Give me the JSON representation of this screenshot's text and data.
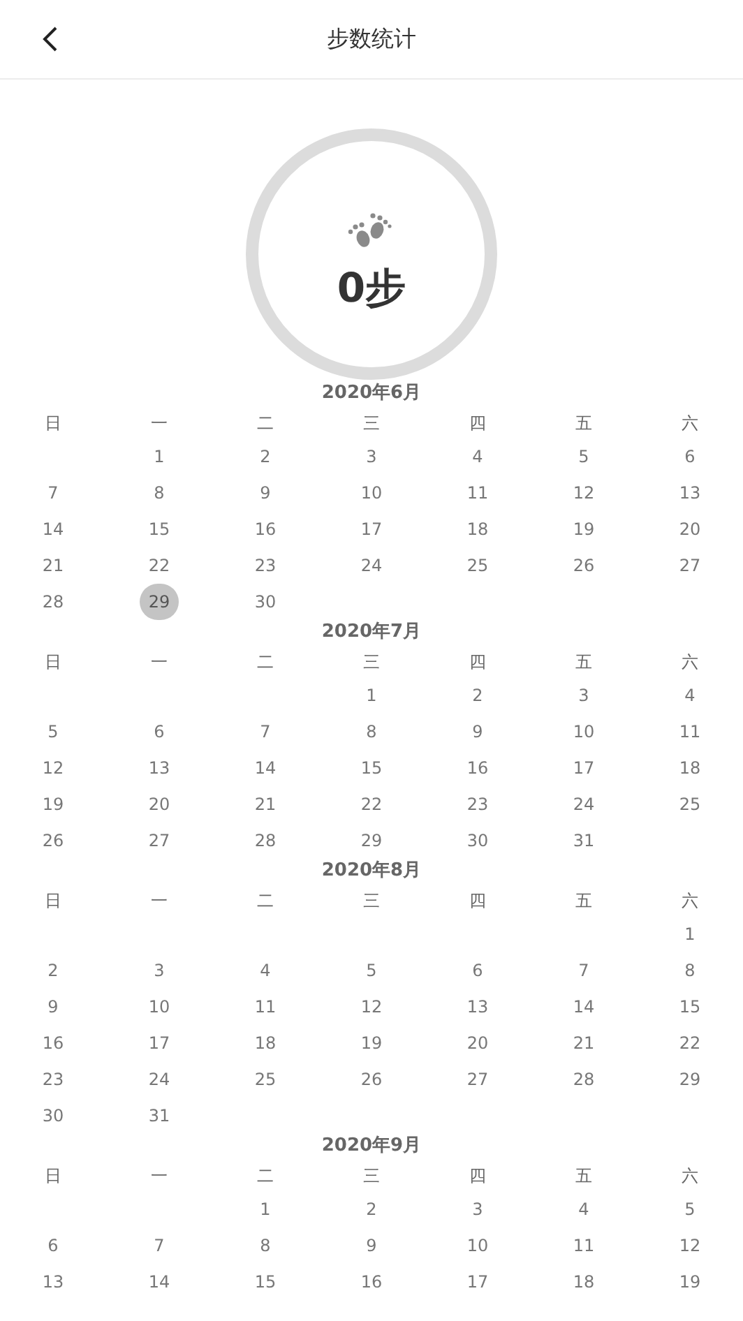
{
  "header": {
    "title": "步数统计"
  },
  "summary": {
    "steps": "0步"
  },
  "months": [
    {
      "title": "2020年6月",
      "weekdays": [
        "日",
        "一",
        "二",
        "三",
        "四",
        "五",
        "六"
      ],
      "weeks": [
        {
          "starts_midweek": true,
          "days": [
            {
              "day": "1",
              "selected": false
            },
            {
              "day": "2",
              "selected": false
            },
            {
              "day": "3",
              "selected": false
            },
            {
              "day": "4",
              "selected": false
            },
            {
              "day": "5",
              "selected": false
            },
            {
              "day": "6",
              "selected": false
            }
          ]
        },
        {
          "days": [
            {
              "day": "7",
              "selected": false
            },
            {
              "day": "8",
              "selected": false
            },
            {
              "day": "9",
              "selected": false
            },
            {
              "day": "10",
              "selected": false
            },
            {
              "day": "11",
              "selected": false
            },
            {
              "day": "12",
              "selected": false
            },
            {
              "day": "13",
              "selected": false
            }
          ]
        },
        {
          "days": [
            {
              "day": "14",
              "selected": false
            },
            {
              "day": "15",
              "selected": false
            },
            {
              "day": "16",
              "selected": false
            },
            {
              "day": "17",
              "selected": false
            },
            {
              "day": "18",
              "selected": false
            },
            {
              "day": "19",
              "selected": false
            },
            {
              "day": "20",
              "selected": false
            }
          ]
        },
        {
          "days": [
            {
              "day": "21",
              "selected": false
            },
            {
              "day": "22",
              "selected": false
            },
            {
              "day": "23",
              "selected": false
            },
            {
              "day": "24",
              "selected": false
            },
            {
              "day": "25",
              "selected": false
            },
            {
              "day": "26",
              "selected": false
            },
            {
              "day": "27",
              "selected": false
            }
          ]
        },
        {
          "starts_midweek": false,
          "days": [
            {
              "day": "28",
              "selected": false
            },
            {
              "day": "29",
              "selected": true
            },
            {
              "day": "30",
              "selected": false
            }
          ]
        }
      ]
    },
    {
      "title": "2020年7月",
      "weekdays": [
        "日",
        "一",
        "二",
        "三",
        "四",
        "五",
        "六"
      ],
      "weeks": [
        {
          "starts_midweek": true,
          "days": [
            {
              "day": "1",
              "selected": false
            },
            {
              "day": "2",
              "selected": false
            },
            {
              "day": "3",
              "selected": false
            },
            {
              "day": "4",
              "selected": false
            }
          ]
        },
        {
          "days": [
            {
              "day": "5",
              "selected": false
            },
            {
              "day": "6",
              "selected": false
            },
            {
              "day": "7",
              "selected": false
            },
            {
              "day": "8",
              "selected": false
            },
            {
              "day": "9",
              "selected": false
            },
            {
              "day": "10",
              "selected": false
            },
            {
              "day": "11",
              "selected": false
            }
          ]
        },
        {
          "days": [
            {
              "day": "12",
              "selected": false
            },
            {
              "day": "13",
              "selected": false
            },
            {
              "day": "14",
              "selected": false
            },
            {
              "day": "15",
              "selected": false
            },
            {
              "day": "16",
              "selected": false
            },
            {
              "day": "17",
              "selected": false
            },
            {
              "day": "18",
              "selected": false
            }
          ]
        },
        {
          "days": [
            {
              "day": "19",
              "selected": false
            },
            {
              "day": "20",
              "selected": false
            },
            {
              "day": "21",
              "selected": false
            },
            {
              "day": "22",
              "selected": false
            },
            {
              "day": "23",
              "selected": false
            },
            {
              "day": "24",
              "selected": false
            },
            {
              "day": "25",
              "selected": false
            }
          ]
        },
        {
          "starts_midweek": false,
          "days": [
            {
              "day": "26",
              "selected": false
            },
            {
              "day": "27",
              "selected": false
            },
            {
              "day": "28",
              "selected": false
            },
            {
              "day": "29",
              "selected": false
            },
            {
              "day": "30",
              "selected": false
            },
            {
              "day": "31",
              "selected": false
            }
          ]
        }
      ]
    },
    {
      "title": "2020年8月",
      "weekdays": [
        "日",
        "一",
        "二",
        "三",
        "四",
        "五",
        "六"
      ],
      "weeks": [
        {
          "starts_midweek": true,
          "days": [
            {
              "day": "1",
              "selected": false
            }
          ]
        },
        {
          "days": [
            {
              "day": "2",
              "selected": false
            },
            {
              "day": "3",
              "selected": false
            },
            {
              "day": "4",
              "selected": false
            },
            {
              "day": "5",
              "selected": false
            },
            {
              "day": "6",
              "selected": false
            },
            {
              "day": "7",
              "selected": false
            },
            {
              "day": "8",
              "selected": false
            }
          ]
        },
        {
          "days": [
            {
              "day": "9",
              "selected": false
            },
            {
              "day": "10",
              "selected": false
            },
            {
              "day": "11",
              "selected": false
            },
            {
              "day": "12",
              "selected": false
            },
            {
              "day": "13",
              "selected": false
            },
            {
              "day": "14",
              "selected": false
            },
            {
              "day": "15",
              "selected": false
            }
          ]
        },
        {
          "days": [
            {
              "day": "16",
              "selected": false
            },
            {
              "day": "17",
              "selected": false
            },
            {
              "day": "18",
              "selected": false
            },
            {
              "day": "19",
              "selected": false
            },
            {
              "day": "20",
              "selected": false
            },
            {
              "day": "21",
              "selected": false
            },
            {
              "day": "22",
              "selected": false
            }
          ]
        },
        {
          "days": [
            {
              "day": "23",
              "selected": false
            },
            {
              "day": "24",
              "selected": false
            },
            {
              "day": "25",
              "selected": false
            },
            {
              "day": "26",
              "selected": false
            },
            {
              "day": "27",
              "selected": false
            },
            {
              "day": "28",
              "selected": false
            },
            {
              "day": "29",
              "selected": false
            }
          ]
        },
        {
          "starts_midweek": false,
          "days": [
            {
              "day": "30",
              "selected": false
            },
            {
              "day": "31",
              "selected": false
            }
          ]
        }
      ]
    },
    {
      "title": "2020年9月",
      "weekdays": [
        "日",
        "一",
        "二",
        "三",
        "四",
        "五",
        "六"
      ],
      "weeks": [
        {
          "starts_midweek": true,
          "days": [
            {
              "day": "1",
              "selected": false
            },
            {
              "day": "2",
              "selected": false
            },
            {
              "day": "3",
              "selected": false
            },
            {
              "day": "4",
              "selected": false
            },
            {
              "day": "5",
              "selected": false
            }
          ]
        },
        {
          "days": [
            {
              "day": "6",
              "selected": false
            },
            {
              "day": "7",
              "selected": false
            },
            {
              "day": "8",
              "selected": false
            },
            {
              "day": "9",
              "selected": false
            },
            {
              "day": "10",
              "selected": false
            },
            {
              "day": "11",
              "selected": false
            },
            {
              "day": "12",
              "selected": false
            }
          ]
        },
        {
          "days": [
            {
              "day": "13",
              "selected": false
            },
            {
              "day": "14",
              "selected": false
            },
            {
              "day": "15",
              "selected": false
            },
            {
              "day": "16",
              "selected": false
            },
            {
              "day": "17",
              "selected": false
            },
            {
              "day": "18",
              "selected": false
            },
            {
              "day": "19",
              "selected": false
            }
          ]
        }
      ]
    }
  ]
}
